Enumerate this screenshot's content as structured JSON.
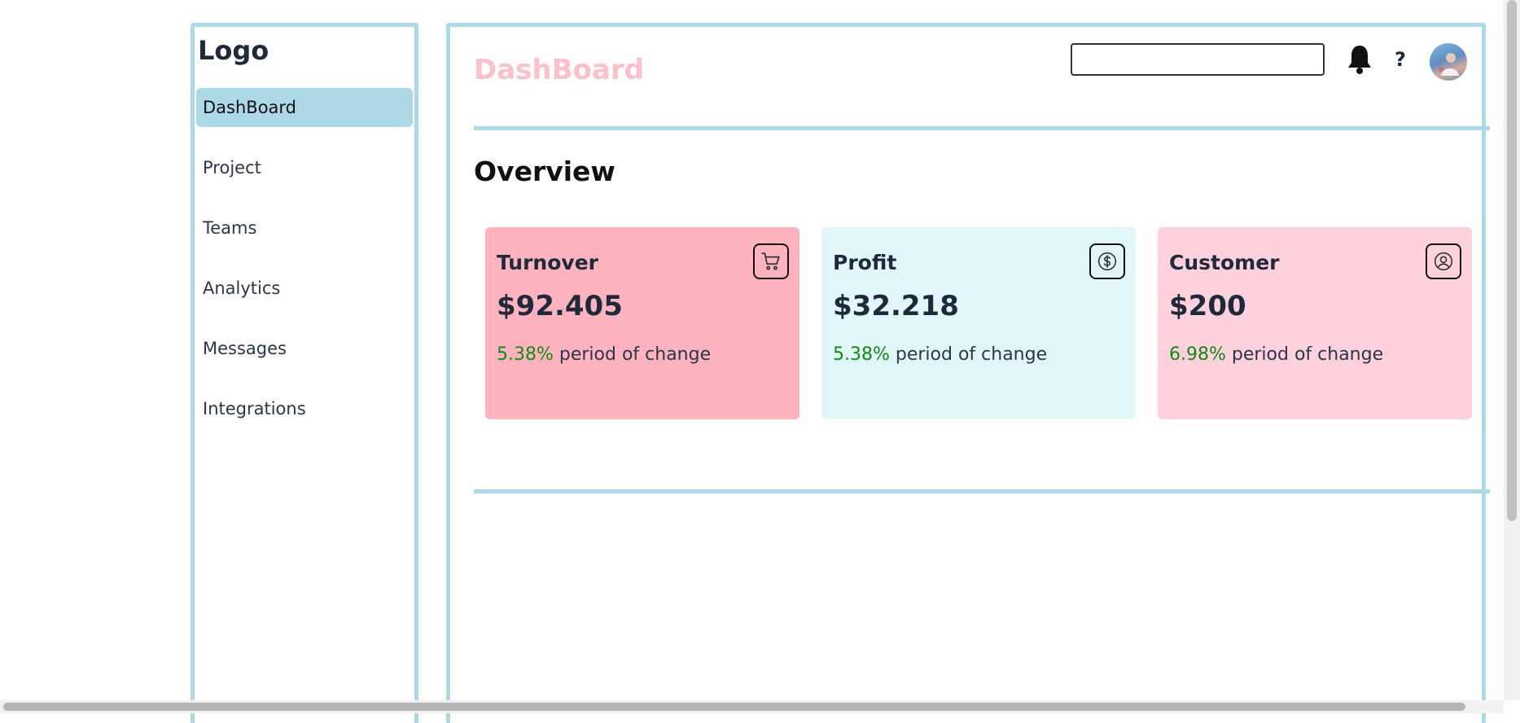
{
  "sidebar": {
    "logo": "Logo",
    "items": [
      {
        "label": "DashBoard",
        "active": true
      },
      {
        "label": "Project"
      },
      {
        "label": "Teams"
      },
      {
        "label": "Analytics"
      },
      {
        "label": "Messages"
      },
      {
        "label": "Integrations"
      }
    ]
  },
  "header": {
    "title": "DashBoard",
    "search": {
      "value": "",
      "placeholder": ""
    },
    "help_label": "?",
    "icons": [
      "bell-icon",
      "help-icon",
      "avatar"
    ]
  },
  "main": {
    "section_title": "Overview",
    "cards": [
      {
        "title": "Turnover",
        "value": "$92.405",
        "change_pct": "5.38%",
        "change_label": "period of change",
        "icon": "cart-icon",
        "bg": "#ffb3be"
      },
      {
        "title": "Profit",
        "value": "$32.218",
        "change_pct": "5.38%",
        "change_label": "period of change",
        "icon": "dollar-icon",
        "bg": "#e0f6f9"
      },
      {
        "title": "Customer",
        "value": "$200",
        "change_pct": "6.98%",
        "change_label": "period of change",
        "icon": "user-icon",
        "bg": "#ffd1dc"
      }
    ]
  },
  "colors": {
    "accent": "#add8e6",
    "title_pink": "#ffc0cb",
    "positive": "#128a12",
    "text": "#1e2a3b"
  }
}
